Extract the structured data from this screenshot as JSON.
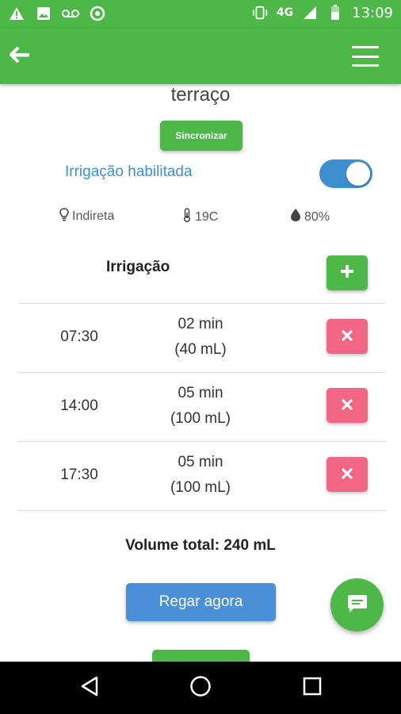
{
  "status_bar": {
    "icons_left": [
      "warning-icon",
      "image-icon",
      "voicemail-icon",
      "whatsapp-icon"
    ],
    "icons_right": [
      "vibrate-icon",
      "signal-icon",
      "battery-icon"
    ],
    "network": "4G",
    "time": "13:09"
  },
  "app_bar": {
    "back_icon": "arrow-left-icon",
    "menu_icon": "hamburger-icon",
    "color": "#4db748"
  },
  "page": {
    "title": "terraço",
    "sync_label": "Sincronizar",
    "irrigation_enabled_label": "Irrigação habilitada",
    "irrigation_enabled": true
  },
  "sensors": {
    "light": "Indireta",
    "temperature": "19C",
    "humidity": "80%"
  },
  "schedule": {
    "title": "Irrigação",
    "rows": [
      {
        "time": "07:30",
        "duration": "02 min",
        "volume": "(40 mL)"
      },
      {
        "time": "14:00",
        "duration": "05 min",
        "volume": "(100 mL)"
      },
      {
        "time": "17:30",
        "duration": "05 min",
        "volume": "(100 mL)"
      }
    ]
  },
  "footer": {
    "total": "Volume total: 240 mL",
    "water_now_label": "Regar agora"
  },
  "colors": {
    "primary_green": "#4db748",
    "accent_blue": "#3e8fd0",
    "delete_pink": "#f06684"
  }
}
